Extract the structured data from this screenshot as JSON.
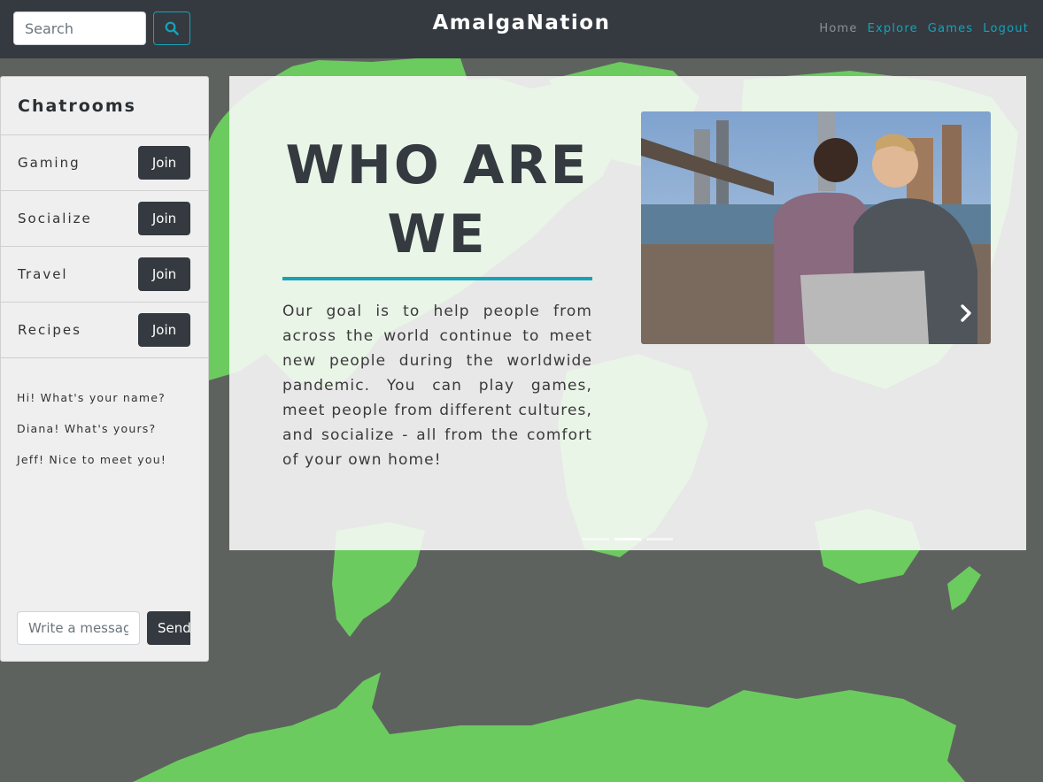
{
  "app": {
    "title": "AmalgaNation"
  },
  "header": {
    "search_placeholder": "Search",
    "search_icon": "search-icon",
    "nav": [
      {
        "label": "Home",
        "active": false
      },
      {
        "label": "Explore",
        "active": true
      },
      {
        "label": "Games",
        "active": true
      },
      {
        "label": "Logout",
        "active": true
      }
    ]
  },
  "sidebar": {
    "title": "Chatrooms",
    "rooms": [
      {
        "label": "Gaming",
        "button": "Join"
      },
      {
        "label": "Socialize",
        "button": "Join"
      },
      {
        "label": "Travel",
        "button": "Join"
      },
      {
        "label": "Recipes",
        "button": "Join"
      }
    ],
    "messages": [
      "Hi! What's your name?",
      "Diana! What's yours?",
      "Jeff! Nice to meet you!"
    ],
    "message_placeholder": "Write a message",
    "send_label": "Send"
  },
  "carousel": {
    "heading": "WHO ARE WE",
    "body": "Our goal is to help people from across the world continue to meet new people during the worldwide pandemic. You can play games, meet people from different cultures, and socialize - all from the comfort of your own home!",
    "next_icon": "chevron-right-icon",
    "slide_count": 3,
    "active_slide": 2
  },
  "colors": {
    "navbar": "#343a40",
    "accent": "#17a2b8",
    "map_land": "#6ccb5f",
    "map_ocean": "#5e625f",
    "button_dark": "#343a40"
  }
}
